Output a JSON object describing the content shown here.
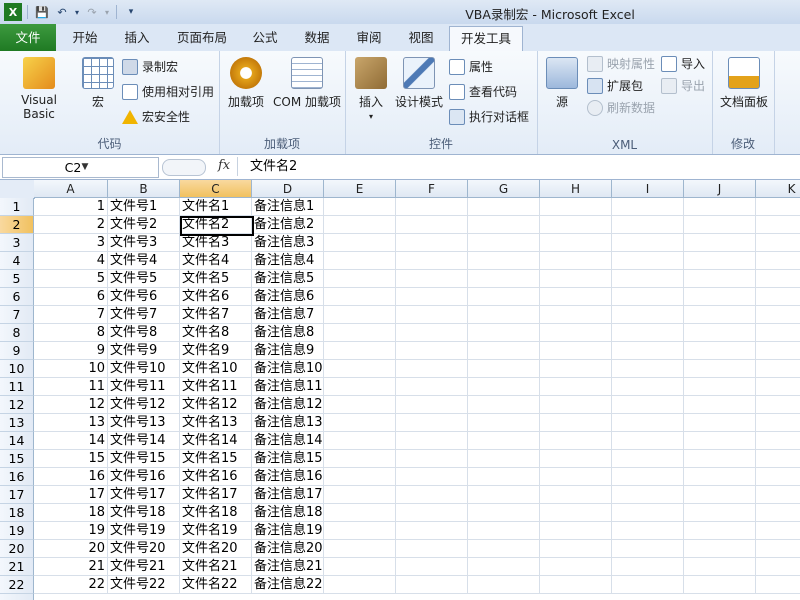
{
  "window": {
    "title": "VBA录制宏 - Microsoft Excel"
  },
  "tabs": [
    "文件",
    "开始",
    "插入",
    "页面布局",
    "公式",
    "数据",
    "审阅",
    "视图",
    "开发工具"
  ],
  "ribbon": {
    "code": {
      "label": "代码",
      "visual_basic": "Visual Basic",
      "macros": "宏",
      "record_macro": "录制宏",
      "relative_refs": "使用相对引用",
      "macro_security": "宏安全性"
    },
    "addins": {
      "label": "加载项",
      "addins": "加载项",
      "com_addins": "COM 加载项"
    },
    "controls": {
      "label": "控件",
      "insert": "插入",
      "design_mode": "设计模式",
      "properties": "属性",
      "view_code": "查看代码",
      "run_dialog": "执行对话框"
    },
    "xml": {
      "label": "XML",
      "source": "源",
      "map_properties": "映射属性",
      "expansion_packs": "扩展包",
      "refresh_data": "刷新数据",
      "import": "导入",
      "export": "导出"
    },
    "modify": {
      "label": "修改",
      "document_panel": "文档面板"
    }
  },
  "formula_bar": {
    "name_box": "C2",
    "fx": "fx",
    "content": "文件名2"
  },
  "columns": [
    "A",
    "B",
    "C",
    "D",
    "E",
    "F",
    "G",
    "H",
    "I",
    "J",
    "K"
  ],
  "rows": [
    {
      "num": "1",
      "a": "1",
      "b": "文件号1",
      "c": "文件名1",
      "d": "备注信息1"
    },
    {
      "num": "2",
      "a": "2",
      "b": "文件号2",
      "c": "文件名2",
      "d": "备注信息2"
    },
    {
      "num": "3",
      "a": "3",
      "b": "文件号3",
      "c": "文件名3",
      "d": "备注信息3"
    },
    {
      "num": "4",
      "a": "4",
      "b": "文件号4",
      "c": "文件名4",
      "d": "备注信息4"
    },
    {
      "num": "5",
      "a": "5",
      "b": "文件号5",
      "c": "文件名5",
      "d": "备注信息5"
    },
    {
      "num": "6",
      "a": "6",
      "b": "文件号6",
      "c": "文件名6",
      "d": "备注信息6"
    },
    {
      "num": "7",
      "a": "7",
      "b": "文件号7",
      "c": "文件名7",
      "d": "备注信息7"
    },
    {
      "num": "8",
      "a": "8",
      "b": "文件号8",
      "c": "文件名8",
      "d": "备注信息8"
    },
    {
      "num": "9",
      "a": "9",
      "b": "文件号9",
      "c": "文件名9",
      "d": "备注信息9"
    },
    {
      "num": "10",
      "a": "10",
      "b": "文件号10",
      "c": "文件名10",
      "d": "备注信息10"
    },
    {
      "num": "11",
      "a": "11",
      "b": "文件号11",
      "c": "文件名11",
      "d": "备注信息11"
    },
    {
      "num": "12",
      "a": "12",
      "b": "文件号12",
      "c": "文件名12",
      "d": "备注信息12"
    },
    {
      "num": "13",
      "a": "13",
      "b": "文件号13",
      "c": "文件名13",
      "d": "备注信息13"
    },
    {
      "num": "14",
      "a": "14",
      "b": "文件号14",
      "c": "文件名14",
      "d": "备注信息14"
    },
    {
      "num": "15",
      "a": "15",
      "b": "文件号15",
      "c": "文件名15",
      "d": "备注信息15"
    },
    {
      "num": "16",
      "a": "16",
      "b": "文件号16",
      "c": "文件名16",
      "d": "备注信息16"
    },
    {
      "num": "17",
      "a": "17",
      "b": "文件号17",
      "c": "文件名17",
      "d": "备注信息17"
    },
    {
      "num": "18",
      "a": "18",
      "b": "文件号18",
      "c": "文件名18",
      "d": "备注信息18"
    },
    {
      "num": "19",
      "a": "19",
      "b": "文件号19",
      "c": "文件名19",
      "d": "备注信息19"
    },
    {
      "num": "20",
      "a": "20",
      "b": "文件号20",
      "c": "文件名20",
      "d": "备注信息20"
    },
    {
      "num": "21",
      "a": "21",
      "b": "文件号21",
      "c": "文件名21",
      "d": "备注信息21"
    },
    {
      "num": "22",
      "a": "22",
      "b": "文件号22",
      "c": "文件名22",
      "d": "备注信息22"
    }
  ],
  "selection": {
    "cell": "C2"
  }
}
